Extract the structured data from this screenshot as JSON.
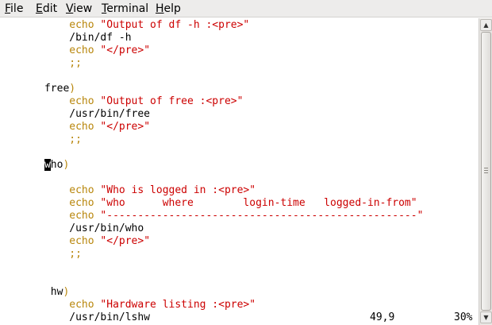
{
  "menu": {
    "items": [
      {
        "mnemonic": "F",
        "rest": "ile"
      },
      {
        "mnemonic": "E",
        "rest": "dit"
      },
      {
        "mnemonic": "V",
        "rest": "iew"
      },
      {
        "mnemonic": "T",
        "rest": "erminal"
      },
      {
        "mnemonic": "H",
        "rest": "elp"
      }
    ]
  },
  "lines": [
    [
      {
        "t": "          ",
        "c": "plain"
      },
      {
        "t": "echo ",
        "c": "keyword"
      },
      {
        "t": "\"Output of df -h :<pre>\"",
        "c": "string"
      }
    ],
    [
      {
        "t": "          /bin/df -h",
        "c": "plain"
      }
    ],
    [
      {
        "t": "          ",
        "c": "plain"
      },
      {
        "t": "echo ",
        "c": "keyword"
      },
      {
        "t": "\"</pre>\"",
        "c": "string"
      }
    ],
    [
      {
        "t": "          ",
        "c": "plain"
      },
      {
        "t": ";;",
        "c": "keyword"
      }
    ],
    [],
    [
      {
        "t": "      free",
        "c": "label"
      },
      {
        "t": ")",
        "c": "keyword"
      }
    ],
    [
      {
        "t": "          ",
        "c": "plain"
      },
      {
        "t": "echo ",
        "c": "keyword"
      },
      {
        "t": "\"Output of free :<pre>\"",
        "c": "string"
      }
    ],
    [
      {
        "t": "          /usr/bin/free",
        "c": "plain"
      }
    ],
    [
      {
        "t": "          ",
        "c": "plain"
      },
      {
        "t": "echo ",
        "c": "keyword"
      },
      {
        "t": "\"</pre>\"",
        "c": "string"
      }
    ],
    [
      {
        "t": "          ",
        "c": "plain"
      },
      {
        "t": ";;",
        "c": "keyword"
      }
    ],
    [],
    [
      {
        "t": "      ",
        "c": "plain"
      },
      {
        "t": "w",
        "c": "cursor"
      },
      {
        "t": "ho",
        "c": "label"
      },
      {
        "t": ")",
        "c": "keyword"
      }
    ],
    [],
    [
      {
        "t": "          ",
        "c": "plain"
      },
      {
        "t": "echo ",
        "c": "keyword"
      },
      {
        "t": "\"Who is logged in :<pre>\"",
        "c": "string"
      }
    ],
    [
      {
        "t": "          ",
        "c": "plain"
      },
      {
        "t": "echo ",
        "c": "keyword"
      },
      {
        "t": "\"who      where        login-time   logged-in-from\"",
        "c": "string"
      }
    ],
    [
      {
        "t": "          ",
        "c": "plain"
      },
      {
        "t": "echo ",
        "c": "keyword"
      },
      {
        "t": "\"--------------------------------------------------\"",
        "c": "string"
      }
    ],
    [
      {
        "t": "          /usr/bin/who",
        "c": "plain"
      }
    ],
    [
      {
        "t": "          ",
        "c": "plain"
      },
      {
        "t": "echo ",
        "c": "keyword"
      },
      {
        "t": "\"</pre>\"",
        "c": "string"
      }
    ],
    [
      {
        "t": "          ",
        "c": "plain"
      },
      {
        "t": ";;",
        "c": "keyword"
      }
    ],
    [],
    [],
    [
      {
        "t": "       hw",
        "c": "label"
      },
      {
        "t": ")",
        "c": "keyword"
      }
    ],
    [
      {
        "t": "          ",
        "c": "plain"
      },
      {
        "t": "echo ",
        "c": "keyword"
      },
      {
        "t": "\"Hardware listing :<pre>\"",
        "c": "string"
      }
    ],
    [
      {
        "t": "          /usr/bin/lshw",
        "c": "plain"
      }
    ]
  ],
  "status": {
    "position": "49,9",
    "percent": "30%"
  },
  "scroll_fraction": 0.3,
  "colors": {
    "keyword": "#b8860b",
    "string": "#cc0000",
    "text": "#000000",
    "background": "#ffffff"
  }
}
